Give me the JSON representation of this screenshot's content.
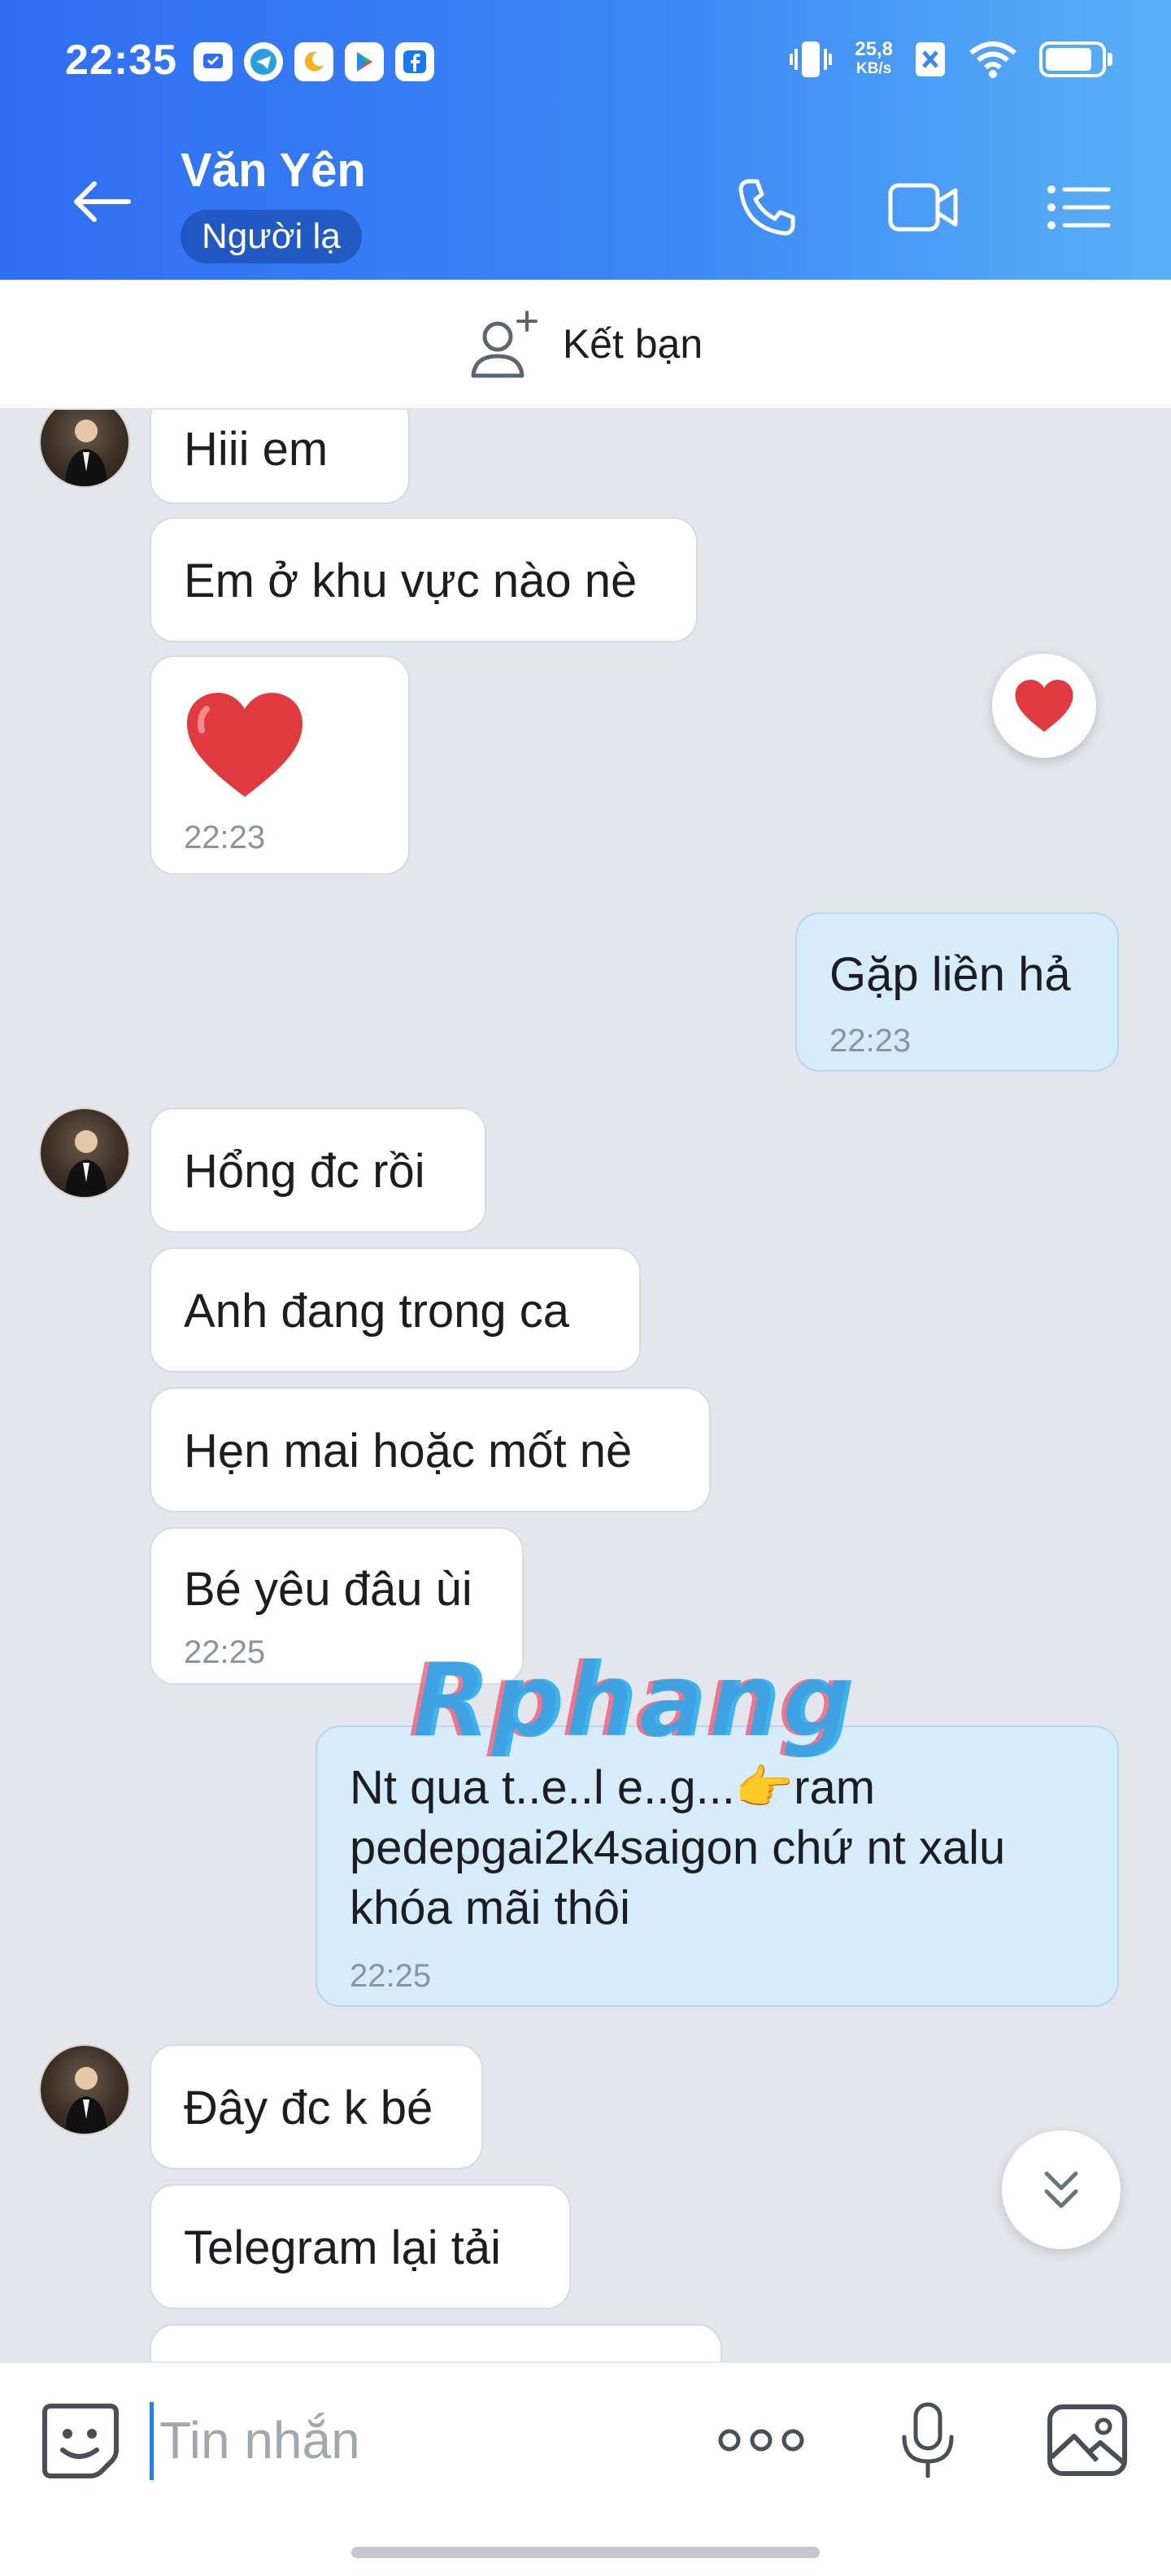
{
  "status_bar": {
    "time": "22:35",
    "net_speed_value": "25,8",
    "net_speed_unit": "KB/s"
  },
  "header": {
    "contact_name": "Văn Yên",
    "badge": "Người lạ"
  },
  "friend_bar": {
    "label": "Kết bạn"
  },
  "messages": {
    "m1": {
      "text": "Hiii em"
    },
    "m2": {
      "text": "Em ở khu vực nào nè"
    },
    "m3": {
      "emoji": "❤️",
      "time": "22:23"
    },
    "m4": {
      "text": "Gặp liền hả",
      "time": "22:23"
    },
    "m5": {
      "text": "Hổng đc rồi"
    },
    "m6": {
      "text": "Anh đang trong ca"
    },
    "m7": {
      "text": "Hẹn mai hoặc mốt nè"
    },
    "m8": {
      "text": "Bé yêu đâu ùi",
      "time": "22:25"
    },
    "m9": {
      "text": "Nt qua t..e..l e..g...👉ram\npedepgai2k4saigon chứ nt xalu\nkhóa mãi thôi",
      "time": "22:25"
    },
    "m10": {
      "text": "Đây đc k bé"
    },
    "m11": {
      "text": "Telegram lại tải"
    }
  },
  "reaction": {
    "emoji": "❤️"
  },
  "watermark": {
    "text": "Rphang"
  },
  "composer": {
    "placeholder": "Tin nhắn"
  },
  "colors": {
    "header_start": "#2f6df2",
    "header_end": "#5ab0f6",
    "my_bubble": "#d6ebfb",
    "their_bubble": "#ffffff",
    "background": "#e3e6ec"
  }
}
